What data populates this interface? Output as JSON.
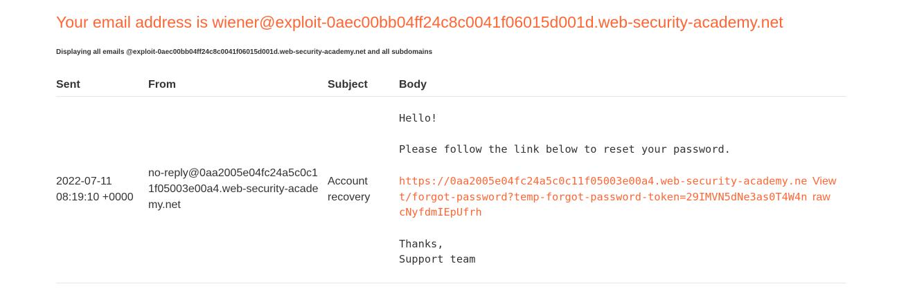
{
  "header": {
    "title": "Your email address is wiener@exploit-0aec00bb04ff24c8c0041f06015d001d.web-security-academy.net",
    "subtitle": "Displaying all emails @exploit-0aec00bb04ff24c8c0041f06015d001d.web-security-academy.net and all subdomains"
  },
  "colors": {
    "accent": "#ff6633",
    "text": "#333332",
    "divider": "#e6e6e6"
  },
  "table": {
    "columns": [
      "Sent",
      "From",
      "Subject",
      "Body"
    ],
    "rows": [
      {
        "sent": "2022-07-11 08:19:10 +0000",
        "from": "no-reply@0aa2005e04fc24a5c0c11f05003e00a4.web-security-academy.net",
        "subject": "Account recovery",
        "body_greeting": "Hello!",
        "body_instruction": "Please follow the link below to reset your password.",
        "body_link": "https://0aa2005e04fc24a5c0c11f05003e00a4.web-security-academy.net/forgot-password?temp-forgot-password-token=29IMVN5dNe3as0T4W4ncNyfdmIEpUfrh",
        "body_thanks": "Thanks,",
        "body_signature": "Support team",
        "action_label": "View raw"
      }
    ]
  }
}
